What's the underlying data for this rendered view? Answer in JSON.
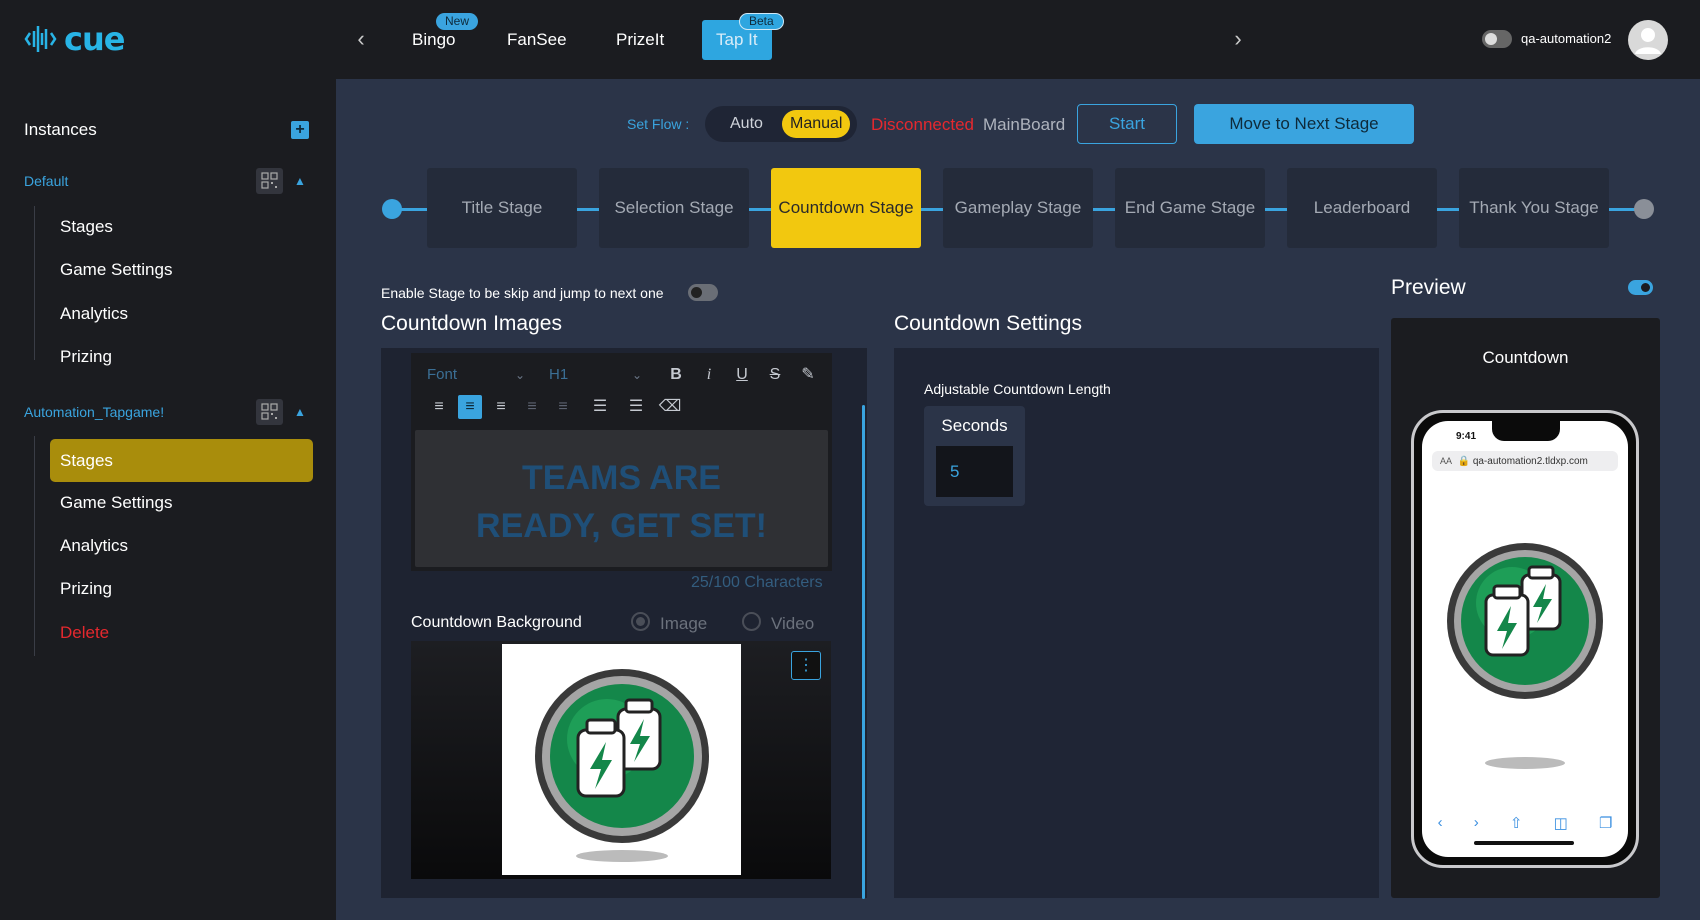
{
  "header": {
    "logo_text": "cue",
    "nav_prev_icon": "chevron-left-icon",
    "nav_next_icon": "chevron-right-icon",
    "nav": [
      {
        "label": "Bingo",
        "badge": "New",
        "active": false
      },
      {
        "label": "FanSee",
        "badge": "",
        "active": false
      },
      {
        "label": "PrizeIt",
        "badge": "",
        "active": false
      },
      {
        "label": "Tap It",
        "badge": "Beta",
        "active": true
      }
    ],
    "username": "qa-automation2"
  },
  "sidebar": {
    "title": "Instances",
    "groups": [
      {
        "name": "Default",
        "items": [
          "Stages",
          "Game Settings",
          "Analytics",
          "Prizing"
        ]
      },
      {
        "name": "Automation_Tapgame!",
        "items": [
          "Stages",
          "Game Settings",
          "Analytics",
          "Prizing",
          "Delete"
        ],
        "active_item": "Stages"
      }
    ]
  },
  "flow": {
    "label": "Set Flow :",
    "options": [
      "Auto",
      "Manual"
    ],
    "selected": "Manual",
    "status": "Disconnected",
    "board": "MainBoard",
    "start_label": "Start",
    "next_label": "Move to Next Stage"
  },
  "stages": [
    "Title Stage",
    "Selection Stage",
    "Countdown Stage",
    "Gameplay Stage",
    "End Game Stage",
    "Leaderboard",
    "Thank You Stage"
  ],
  "current_stage": "Countdown Stage",
  "skip_label": "Enable Stage to be skip and jump to next one",
  "images": {
    "title": "Countdown Images",
    "font_placeholder": "Font",
    "heading_value": "H1",
    "editor_text": "TEAMS ARE READY, GET SET!",
    "char_count": "25/100 Characters",
    "background_label": "Countdown Background",
    "bg_options": [
      "Image",
      "Video"
    ],
    "bg_selected": "Image"
  },
  "settings": {
    "title": "Countdown Settings",
    "length_label": "Adjustable Countdown Length",
    "unit": "Seconds",
    "value": "5"
  },
  "preview": {
    "title": "Preview",
    "label": "Countdown",
    "phone_time": "9:41",
    "url": "qa-automation2.tldxp.com",
    "url_prefix": "AA"
  },
  "colors": {
    "accent": "#3aa4df",
    "highlight": "#f2c80f",
    "danger": "#e5282e",
    "background": "#2b3448",
    "sidebar": "#1b1c20"
  }
}
